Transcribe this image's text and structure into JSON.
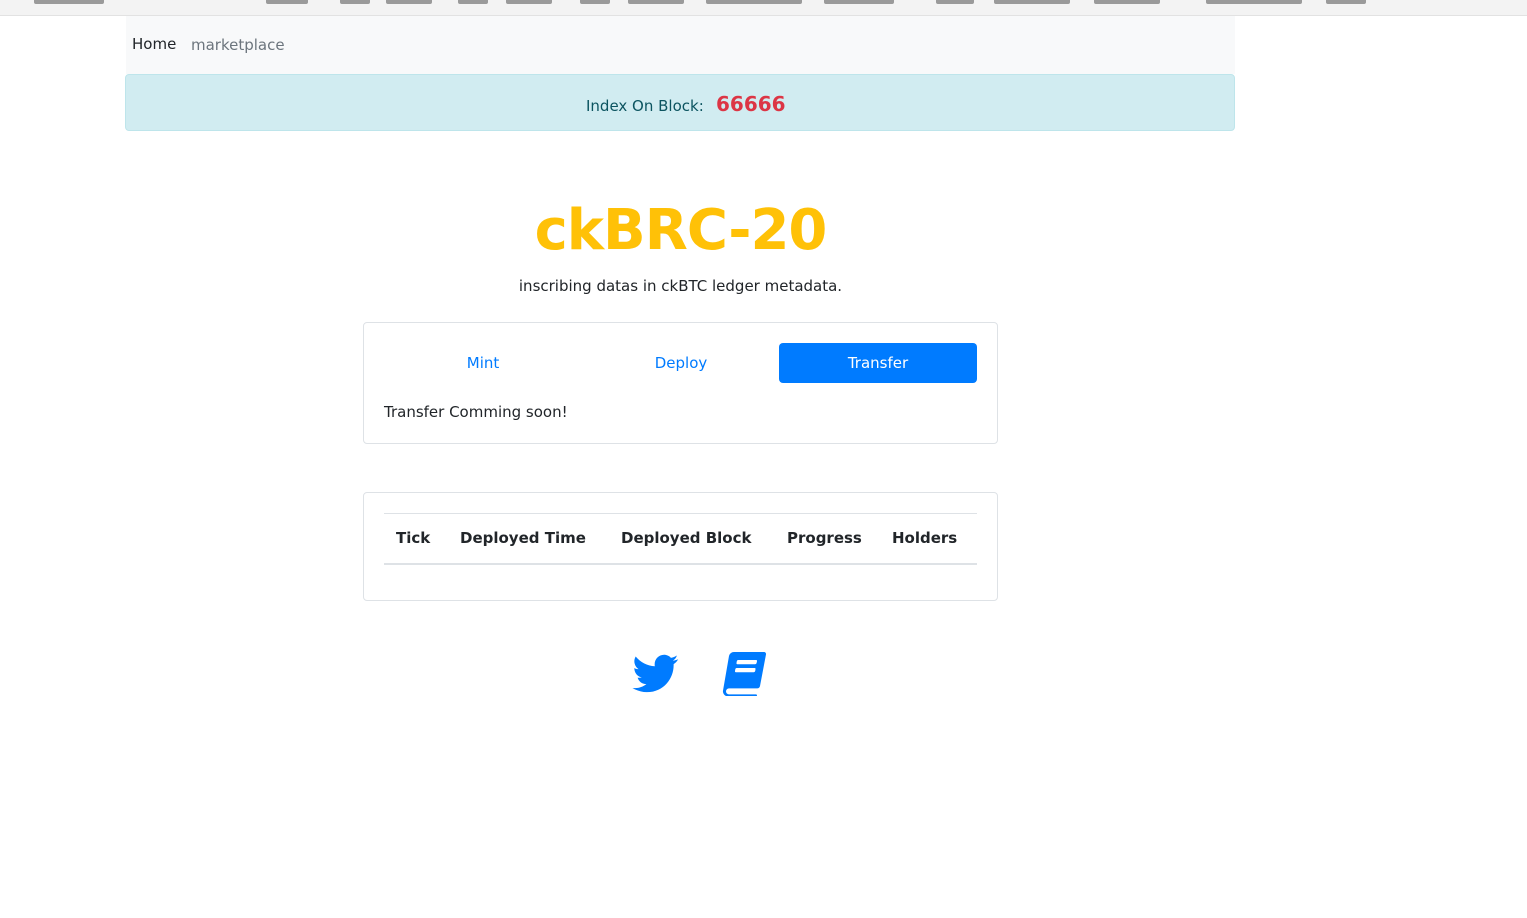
{
  "navbar": {
    "brand": "Home",
    "link": "marketplace"
  },
  "index_alert": {
    "label": "Index On Block:",
    "block": "66666"
  },
  "hero": {
    "title": "ckBRC-20",
    "subtitle": "inscribing datas in ckBTC ledger metadata."
  },
  "tabs": {
    "items": [
      {
        "label": "Mint"
      },
      {
        "label": "Deploy"
      },
      {
        "label": "Transfer"
      }
    ],
    "active": "Transfer",
    "content": "Transfer Comming soon!"
  },
  "table": {
    "columns": [
      "Tick",
      "Deployed Time",
      "Deployed Block",
      "Progress",
      "Holders"
    ],
    "rows": []
  },
  "social": {
    "icons": [
      "twitter-icon",
      "book-icon"
    ]
  },
  "colors": {
    "title": "#ffc107",
    "primary": "#007bff",
    "block_number": "#dc3545",
    "alert_bg": "#d1ecf1"
  }
}
